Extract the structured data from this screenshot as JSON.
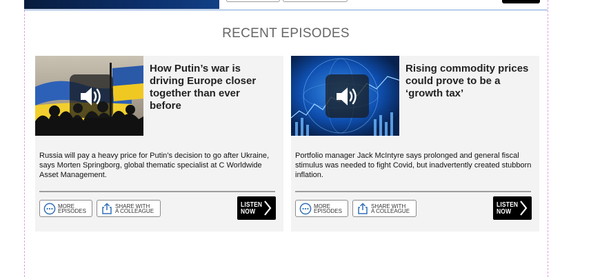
{
  "section": {
    "title": "RECENT EPISODES"
  },
  "episodes": [
    {
      "title": "How Putin’s war is driving Europe closer together than ever before",
      "description": "Russia will pay a heavy price for Putin’s decision to go after Ukraine, says Morten Springborg, global thematic specialist at C Worldwide Asset Management.",
      "more_label_1": "MORE",
      "more_label_2": "EPISODES",
      "share_label_1": "SHARE WITH",
      "share_label_2": "A COLLEAGUE",
      "listen_label_1": "LISTEN",
      "listen_label_2": "NOW"
    },
    {
      "title": "Rising commodity prices could prove to be a ‘growth tax’",
      "description": "Portfolio manager Jack McIntyre says prolonged and general fiscal stimulus was needed to fight Covid, but inadvertently created stubborn inflation.",
      "more_label_1": "MORE",
      "more_label_2": "EPISODES",
      "share_label_1": "SHARE WITH",
      "share_label_2": "A COLLEAGUE",
      "listen_label_1": "LISTEN",
      "listen_label_2": "NOW"
    }
  ],
  "icons": {
    "play": "speaker-icon",
    "more": "ellipsis-circle-icon",
    "share": "share-icon",
    "listen": "chevron-right-icon"
  },
  "colors": {
    "card_background": "#f3f3f3",
    "listen_button": "#000000",
    "section_title": "#666666",
    "ukraine_blue": "#1f5fbf",
    "ukraine_yellow": "#f4d230"
  }
}
